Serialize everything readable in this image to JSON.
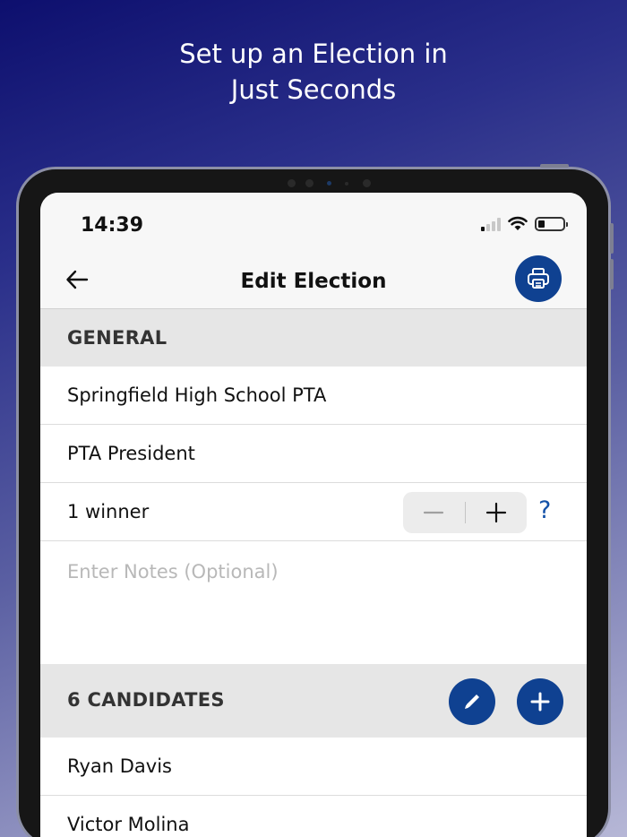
{
  "promo": {
    "line1": "Set up an Election in",
    "line2": "Just Seconds"
  },
  "status_bar": {
    "time": "14:39",
    "icons": [
      "signal-icon",
      "wifi-icon",
      "battery-icon"
    ]
  },
  "nav": {
    "title": "Edit Election",
    "back_icon": "arrow-left-icon",
    "print_icon": "print-icon"
  },
  "general": {
    "header": "GENERAL",
    "organization": "Springfield High School PTA",
    "position": "PTA President",
    "winners": "1 winner",
    "help": "?",
    "notes_placeholder": "Enter Notes (Optional)"
  },
  "candidates": {
    "header": "6 CANDIDATES",
    "items": [
      "Ryan Davis",
      "Victor Molina"
    ]
  },
  "colors": {
    "accent": "#0f4191",
    "help": "#1351a8",
    "section_bg": "#e6e6e6"
  }
}
